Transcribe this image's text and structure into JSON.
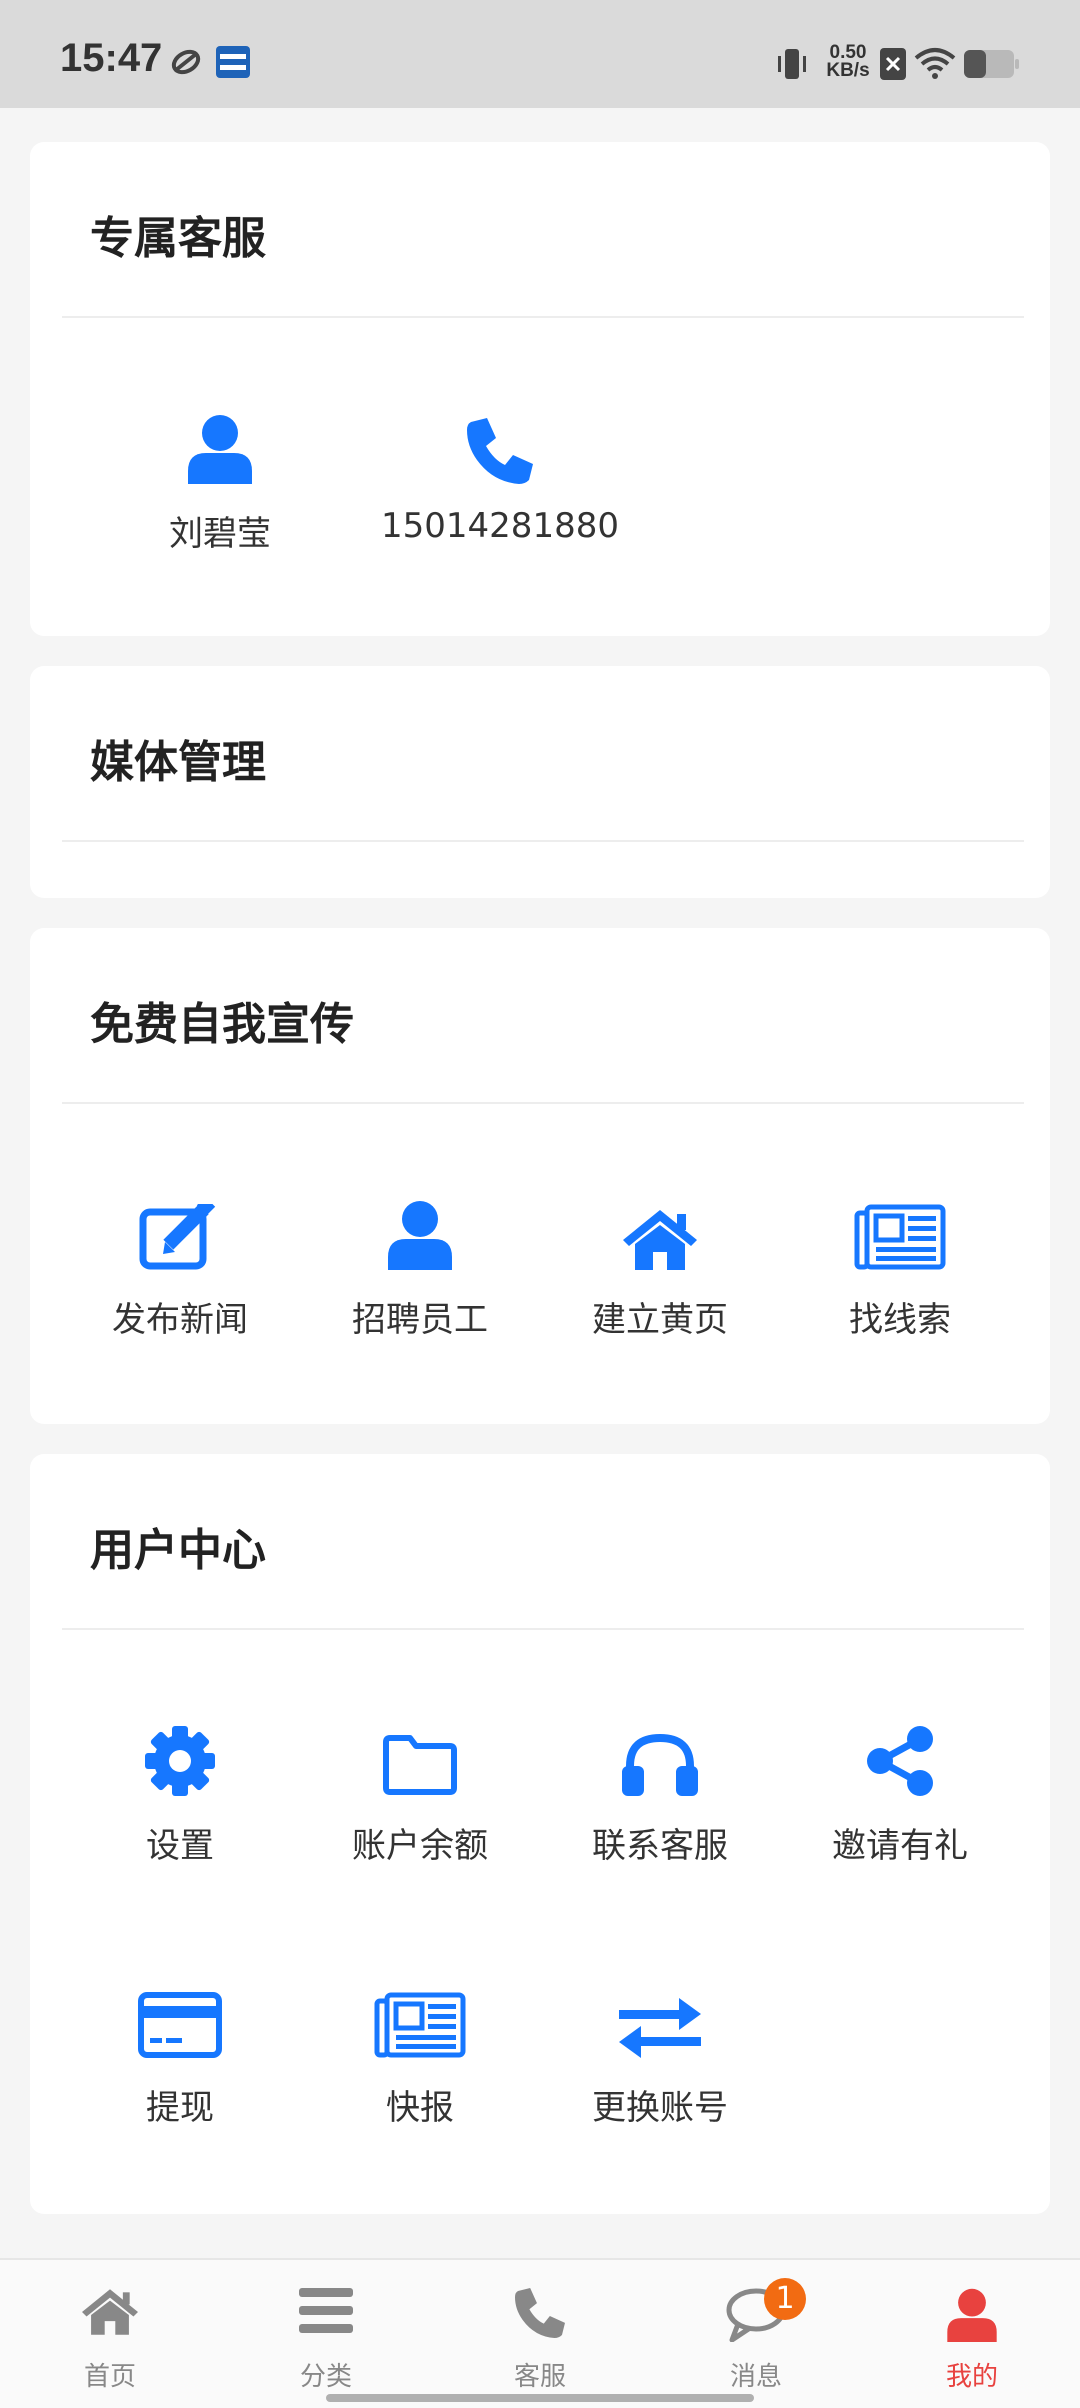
{
  "status_bar": {
    "time": "15:47",
    "net_speed_value": "0.50",
    "net_speed_unit": "KB/s",
    "icons": [
      "sync-icon",
      "app-icon",
      "vibrate-icon",
      "sim-off-icon",
      "wifi-icon",
      "battery-icon"
    ]
  },
  "colors": {
    "accent": "#1677ff",
    "nav_active": "#e8423f",
    "nav_inactive": "#888888",
    "badge": "#f26b12"
  },
  "exclusive_service": {
    "title": "专属客服",
    "contact_name": "刘碧莹",
    "contact_phone": "15014281880"
  },
  "media_management": {
    "title": "媒体管理"
  },
  "free_promotion": {
    "title": "免费自我宣传",
    "items": [
      {
        "label": "发布新闻",
        "icon": "edit-icon"
      },
      {
        "label": "招聘员工",
        "icon": "user-icon"
      },
      {
        "label": "建立黄页",
        "icon": "home-icon"
      },
      {
        "label": "找线索",
        "icon": "newspaper-icon"
      }
    ]
  },
  "user_center": {
    "title": "用户中心",
    "items": [
      {
        "label": "设置",
        "icon": "gear-icon"
      },
      {
        "label": "账户余额",
        "icon": "folder-icon"
      },
      {
        "label": "联系客服",
        "icon": "headset-icon"
      },
      {
        "label": "邀请有礼",
        "icon": "share-icon"
      },
      {
        "label": "提现",
        "icon": "credit-card-icon"
      },
      {
        "label": "快报",
        "icon": "newspaper-icon"
      },
      {
        "label": "更换账号",
        "icon": "swap-icon"
      }
    ]
  },
  "bottom_nav": {
    "items": [
      {
        "label": "首页",
        "icon": "home-icon"
      },
      {
        "label": "分类",
        "icon": "menu-icon"
      },
      {
        "label": "客服",
        "icon": "phone-icon"
      },
      {
        "label": "消息",
        "icon": "chat-icon",
        "badge": "1"
      },
      {
        "label": "我的",
        "icon": "user-icon",
        "active": true
      }
    ]
  }
}
